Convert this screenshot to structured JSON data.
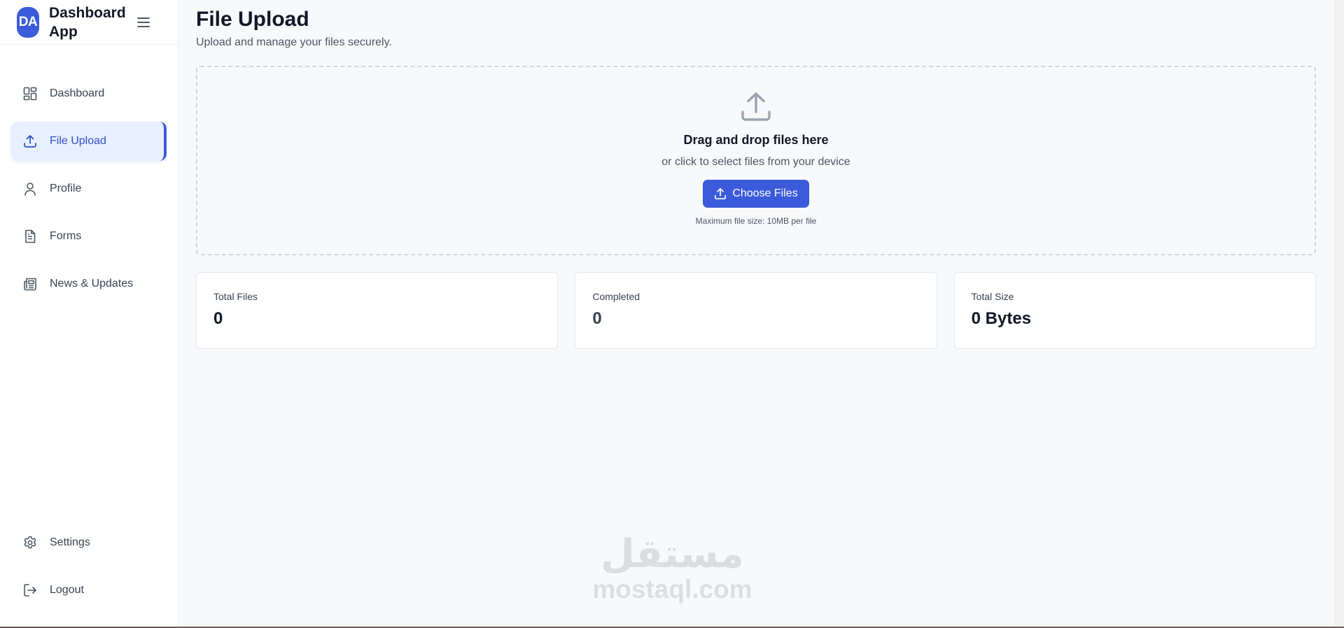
{
  "brand": {
    "logo_text": "DA",
    "name": "Dashboard App"
  },
  "sidebar": {
    "items": [
      {
        "label": "Dashboard",
        "icon": "grid-icon"
      },
      {
        "label": "File Upload",
        "icon": "upload-icon",
        "active": true
      },
      {
        "label": "Profile",
        "icon": "user-icon"
      },
      {
        "label": "Forms",
        "icon": "document-icon"
      },
      {
        "label": "News & Updates",
        "icon": "newspaper-icon"
      }
    ],
    "bottom_items": [
      {
        "label": "Settings",
        "icon": "gear-icon"
      },
      {
        "label": "Logout",
        "icon": "logout-icon"
      }
    ]
  },
  "page": {
    "title": "File Upload",
    "subtitle": "Upload and manage your files securely."
  },
  "dropzone": {
    "title": "Drag and drop files here",
    "subtitle": "or click to select files from your device",
    "button_label": "Choose Files",
    "hint": "Maximum file size: 10MB per file"
  },
  "stats": [
    {
      "label": "Total Files",
      "value": "0"
    },
    {
      "label": "Completed",
      "value": "0"
    },
    {
      "label": "Total Size",
      "value": "0 Bytes"
    }
  ],
  "watermark": {
    "arabic": "مستقل",
    "latin": "mostaql.com"
  },
  "colors": {
    "accent": "#3b5bdb",
    "active_bg": "#e8efff",
    "background": "#f8f9fb"
  }
}
